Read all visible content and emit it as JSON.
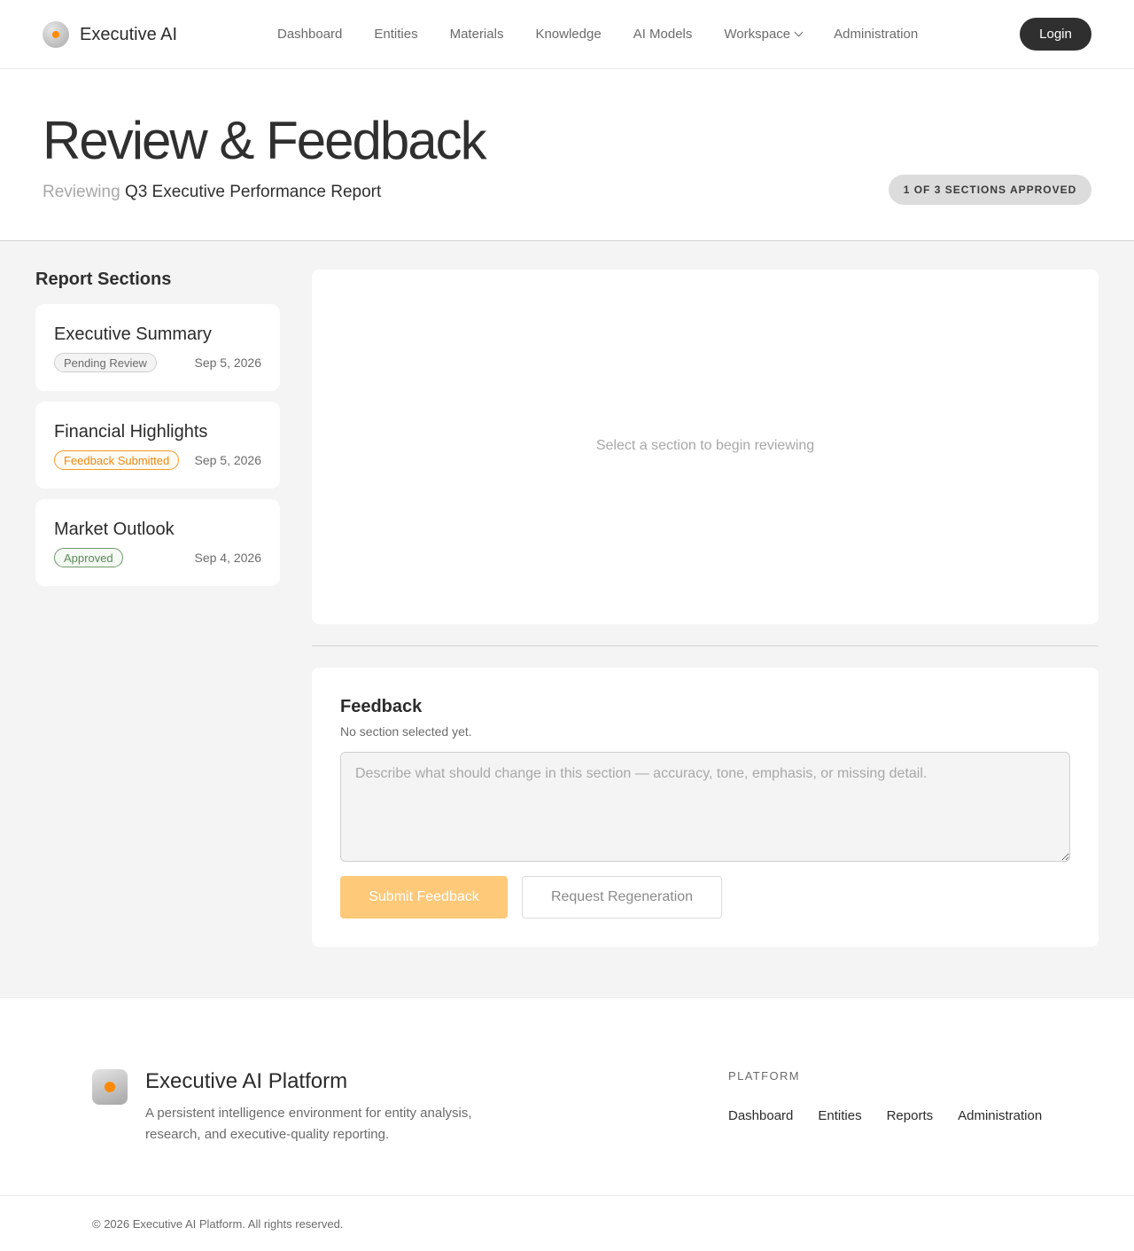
{
  "brand": {
    "name": "Executive AI"
  },
  "nav": {
    "items": [
      "Dashboard",
      "Entities",
      "Materials",
      "Knowledge",
      "AI Models",
      "Workspace",
      "Administration"
    ],
    "login_label": "Login"
  },
  "hero": {
    "title": "Review & Feedback",
    "subtitle_prefix": "Reviewing",
    "document_name": "Q3 Executive Performance Report",
    "approval_status": "1 OF 3 SECTIONS APPROVED"
  },
  "sidebar": {
    "title": "Report Sections",
    "sections": [
      {
        "name": "Executive Summary",
        "status": "Pending Review",
        "date": "Sep 5, 2026"
      },
      {
        "name": "Financial Highlights",
        "status": "Feedback Submitted",
        "date": "Sep 5, 2026"
      },
      {
        "name": "Market Outlook",
        "status": "Approved",
        "date": "Sep 4, 2026"
      }
    ]
  },
  "review": {
    "empty_message": "Select a section to begin reviewing"
  },
  "feedback": {
    "title": "Feedback",
    "subtitle": "No section selected yet.",
    "placeholder": "Describe what should change in this section — accuracy, tone, emphasis, or missing detail.",
    "value": "",
    "submit_label": "Submit Feedback",
    "regen_label": "Request Regeneration"
  },
  "footer": {
    "name": "Executive AI Platform",
    "description": "A persistent intelligence environment for entity analysis, research, and executive-quality reporting.",
    "heading": "PLATFORM",
    "links": [
      "Dashboard",
      "Entities",
      "Reports",
      "Administration"
    ],
    "copyright": "© 2026 Executive AI Platform. All rights reserved."
  },
  "colors": {
    "accent": "#ff8a00",
    "submit_disabled": "#ffc97a",
    "dark": "#2f2f2f",
    "pending": "#6b6b6b",
    "feedback": "#e88a14",
    "approved": "#5a8a57"
  }
}
